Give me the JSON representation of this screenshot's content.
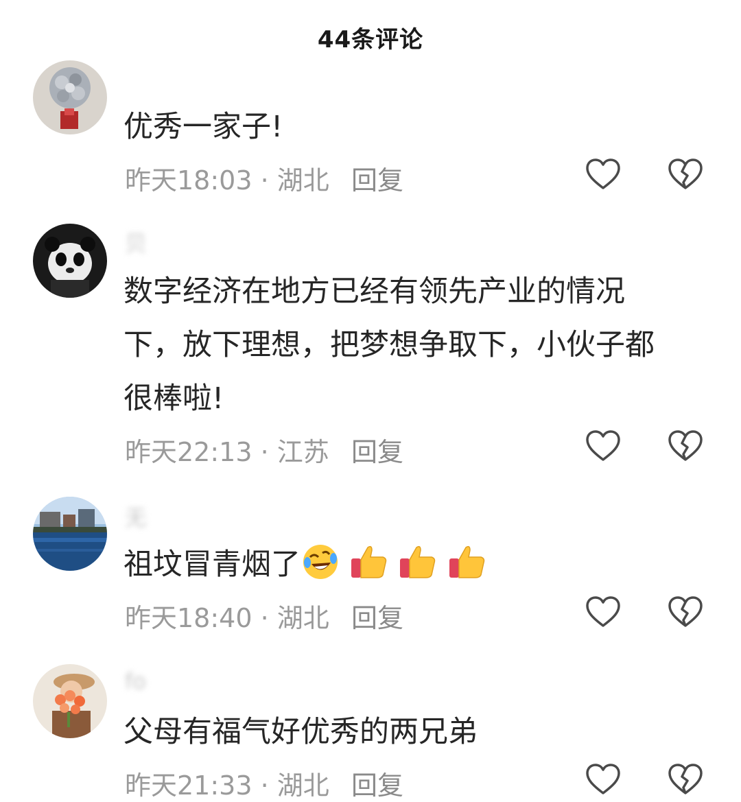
{
  "header": {
    "title": "44条评论"
  },
  "comments": [
    {
      "username": "",
      "text_lines": [
        "优秀一家子!"
      ],
      "time": "昨天18:03",
      "location": "湖北",
      "reply_label": "回复"
    },
    {
      "username": "贝",
      "text_lines": [
        "数字经济在地方已经有领先产业的情况",
        "下，放下理想，把梦想争取下，小伙子都",
        "很棒啦!"
      ],
      "time": "昨天22:13",
      "location": "江苏",
      "reply_label": "回复"
    },
    {
      "username": "无",
      "text_lines": [
        "祖坟冒青烟了"
      ],
      "emojis": [
        "rolling-laugh-emoji",
        "thumbs-up-emoji",
        "thumbs-up-emoji",
        "thumbs-up-emoji"
      ],
      "time": "昨天18:40",
      "location": "湖北",
      "reply_label": "回复"
    },
    {
      "username": "fo",
      "text_lines": [
        "父母有福气好优秀的两兄弟"
      ],
      "time": "昨天21:33",
      "location": "湖北",
      "reply_label": "回复"
    }
  ],
  "meta_separator": " · ",
  "icons": {
    "like": "heart-outline-icon",
    "dislike": "broken-heart-outline-icon"
  },
  "colors": {
    "meta_text": "#9a9a9a",
    "icon_stroke": "#4a4a4a",
    "body_text": "#262626"
  }
}
